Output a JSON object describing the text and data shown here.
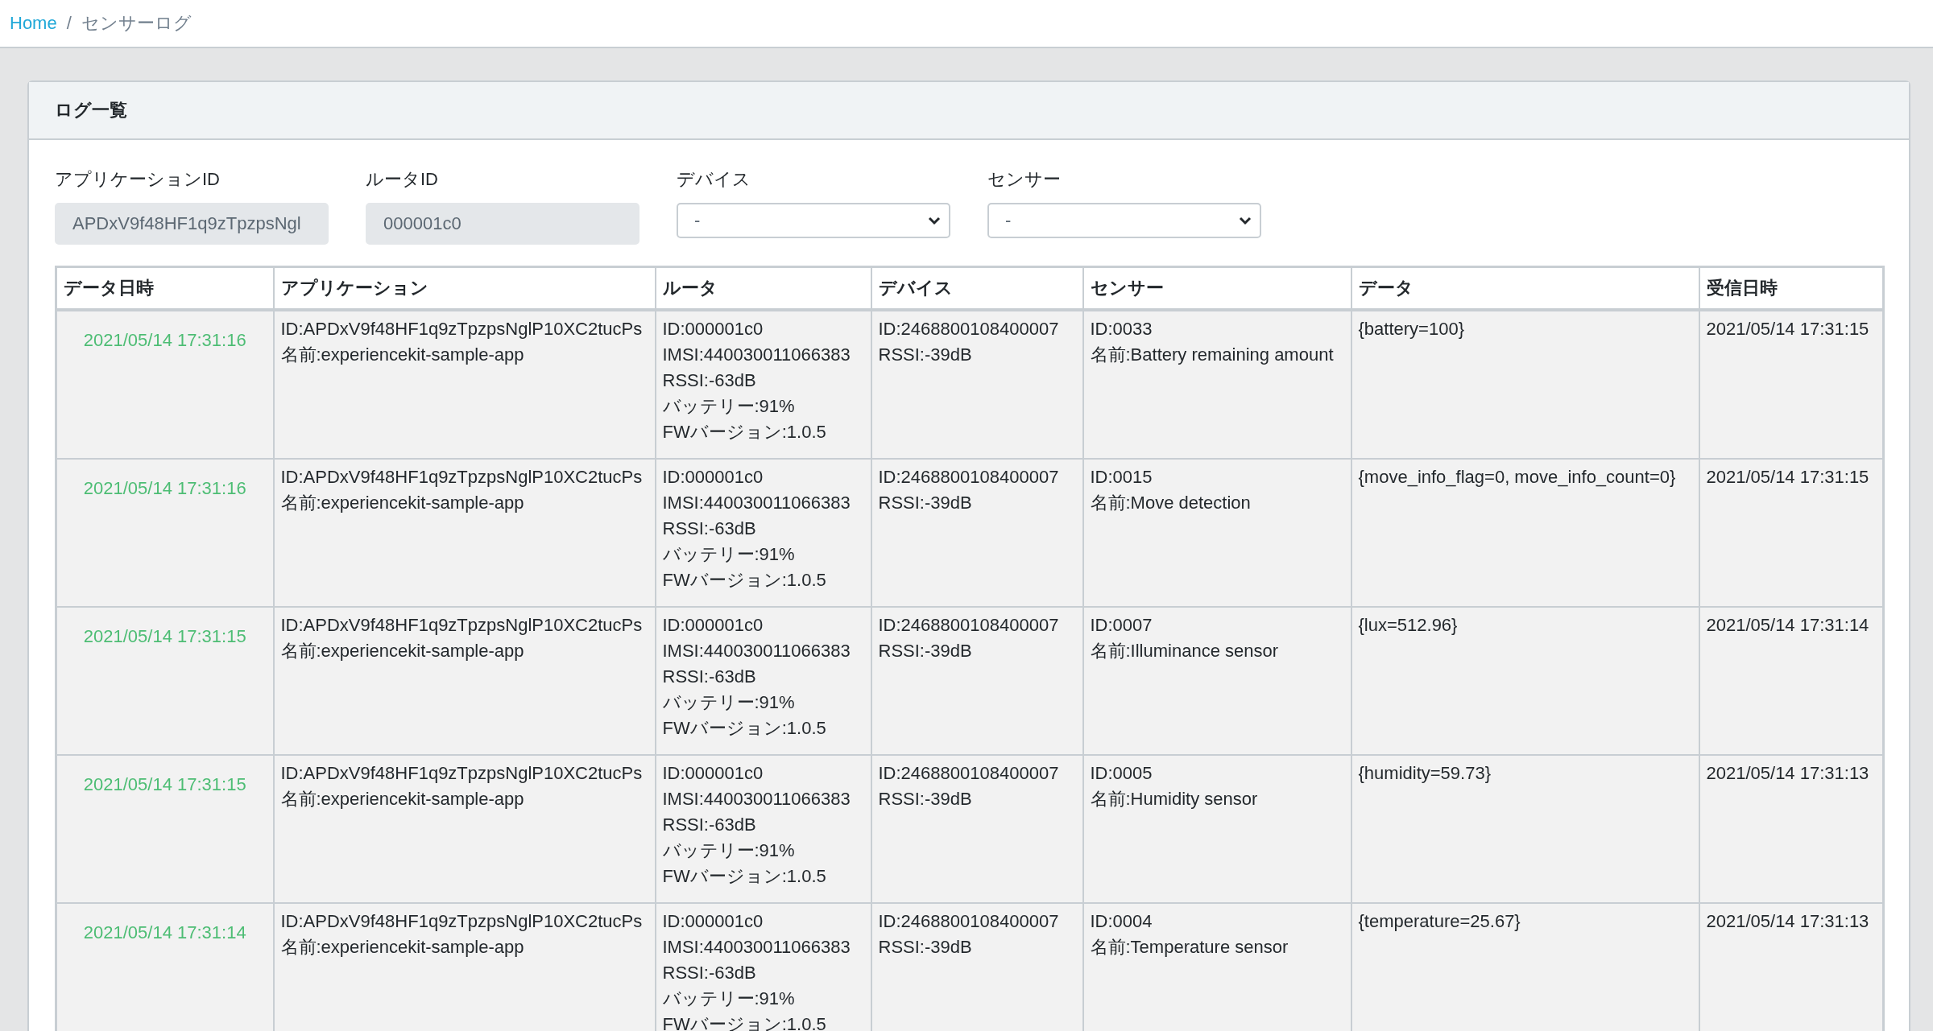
{
  "breadcrumb": {
    "items": [
      {
        "label": "Home",
        "kind": "link"
      },
      {
        "label": "センサーログ",
        "kind": "current"
      }
    ],
    "separator": "/"
  },
  "card": {
    "title": "ログ一覧"
  },
  "filters": [
    {
      "label": "アプリケーションID",
      "kind": "readonly",
      "value": "APDxV9f48HF1q9zTpzpsNgl"
    },
    {
      "label": "ルータID",
      "kind": "readonly",
      "value": "000001c0"
    },
    {
      "label": "デバイス",
      "kind": "select",
      "value": "-"
    },
    {
      "label": "センサー",
      "kind": "select",
      "value": "-"
    }
  ],
  "table": {
    "columns": [
      "データ日時",
      "アプリケーション",
      "ルータ",
      "デバイス",
      "センサー",
      "データ",
      "受信日時"
    ],
    "rows": [
      {
        "data_time": "2021/05/14 17:31:16",
        "application": [
          "ID:APDxV9f48HF1q9zTpzpsNglP10XC2tucPs",
          "名前:experiencekit-sample-app"
        ],
        "router": [
          "ID:000001c0",
          "IMSI:440030011066383",
          "RSSI:-63dB",
          "バッテリー:91%",
          "FWバージョン:1.0.5"
        ],
        "device": [
          "ID:2468800108400007",
          "RSSI:-39dB"
        ],
        "sensor": [
          "ID:0033",
          "名前:Battery remaining amount"
        ],
        "data": "{battery=100}",
        "received": "2021/05/14 17:31:15"
      },
      {
        "data_time": "2021/05/14 17:31:16",
        "application": [
          "ID:APDxV9f48HF1q9zTpzpsNglP10XC2tucPs",
          "名前:experiencekit-sample-app"
        ],
        "router": [
          "ID:000001c0",
          "IMSI:440030011066383",
          "RSSI:-63dB",
          "バッテリー:91%",
          "FWバージョン:1.0.5"
        ],
        "device": [
          "ID:2468800108400007",
          "RSSI:-39dB"
        ],
        "sensor": [
          "ID:0015",
          "名前:Move detection"
        ],
        "data": "{move_info_flag=0, move_info_count=0}",
        "received": "2021/05/14 17:31:15"
      },
      {
        "data_time": "2021/05/14 17:31:15",
        "application": [
          "ID:APDxV9f48HF1q9zTpzpsNglP10XC2tucPs",
          "名前:experiencekit-sample-app"
        ],
        "router": [
          "ID:000001c0",
          "IMSI:440030011066383",
          "RSSI:-63dB",
          "バッテリー:91%",
          "FWバージョン:1.0.5"
        ],
        "device": [
          "ID:2468800108400007",
          "RSSI:-39dB"
        ],
        "sensor": [
          "ID:0007",
          "名前:Illuminance sensor"
        ],
        "data": "{lux=512.96}",
        "received": "2021/05/14 17:31:14"
      },
      {
        "data_time": "2021/05/14 17:31:15",
        "application": [
          "ID:APDxV9f48HF1q9zTpzpsNglP10XC2tucPs",
          "名前:experiencekit-sample-app"
        ],
        "router": [
          "ID:000001c0",
          "IMSI:440030011066383",
          "RSSI:-63dB",
          "バッテリー:91%",
          "FWバージョン:1.0.5"
        ],
        "device": [
          "ID:2468800108400007",
          "RSSI:-39dB"
        ],
        "sensor": [
          "ID:0005",
          "名前:Humidity sensor"
        ],
        "data": "{humidity=59.73}",
        "received": "2021/05/14 17:31:13"
      },
      {
        "data_time": "2021/05/14 17:31:14",
        "application": [
          "ID:APDxV9f48HF1q9zTpzpsNglP10XC2tucPs",
          "名前:experiencekit-sample-app"
        ],
        "router": [
          "ID:000001c0",
          "IMSI:440030011066383",
          "RSSI:-63dB",
          "バッテリー:91%",
          "FWバージョン:1.0.5"
        ],
        "device": [
          "ID:2468800108400007",
          "RSSI:-39dB"
        ],
        "sensor": [
          "ID:0004",
          "名前:Temperature sensor"
        ],
        "data": "{temperature=25.67}",
        "received": "2021/05/14 17:31:13"
      }
    ]
  }
}
